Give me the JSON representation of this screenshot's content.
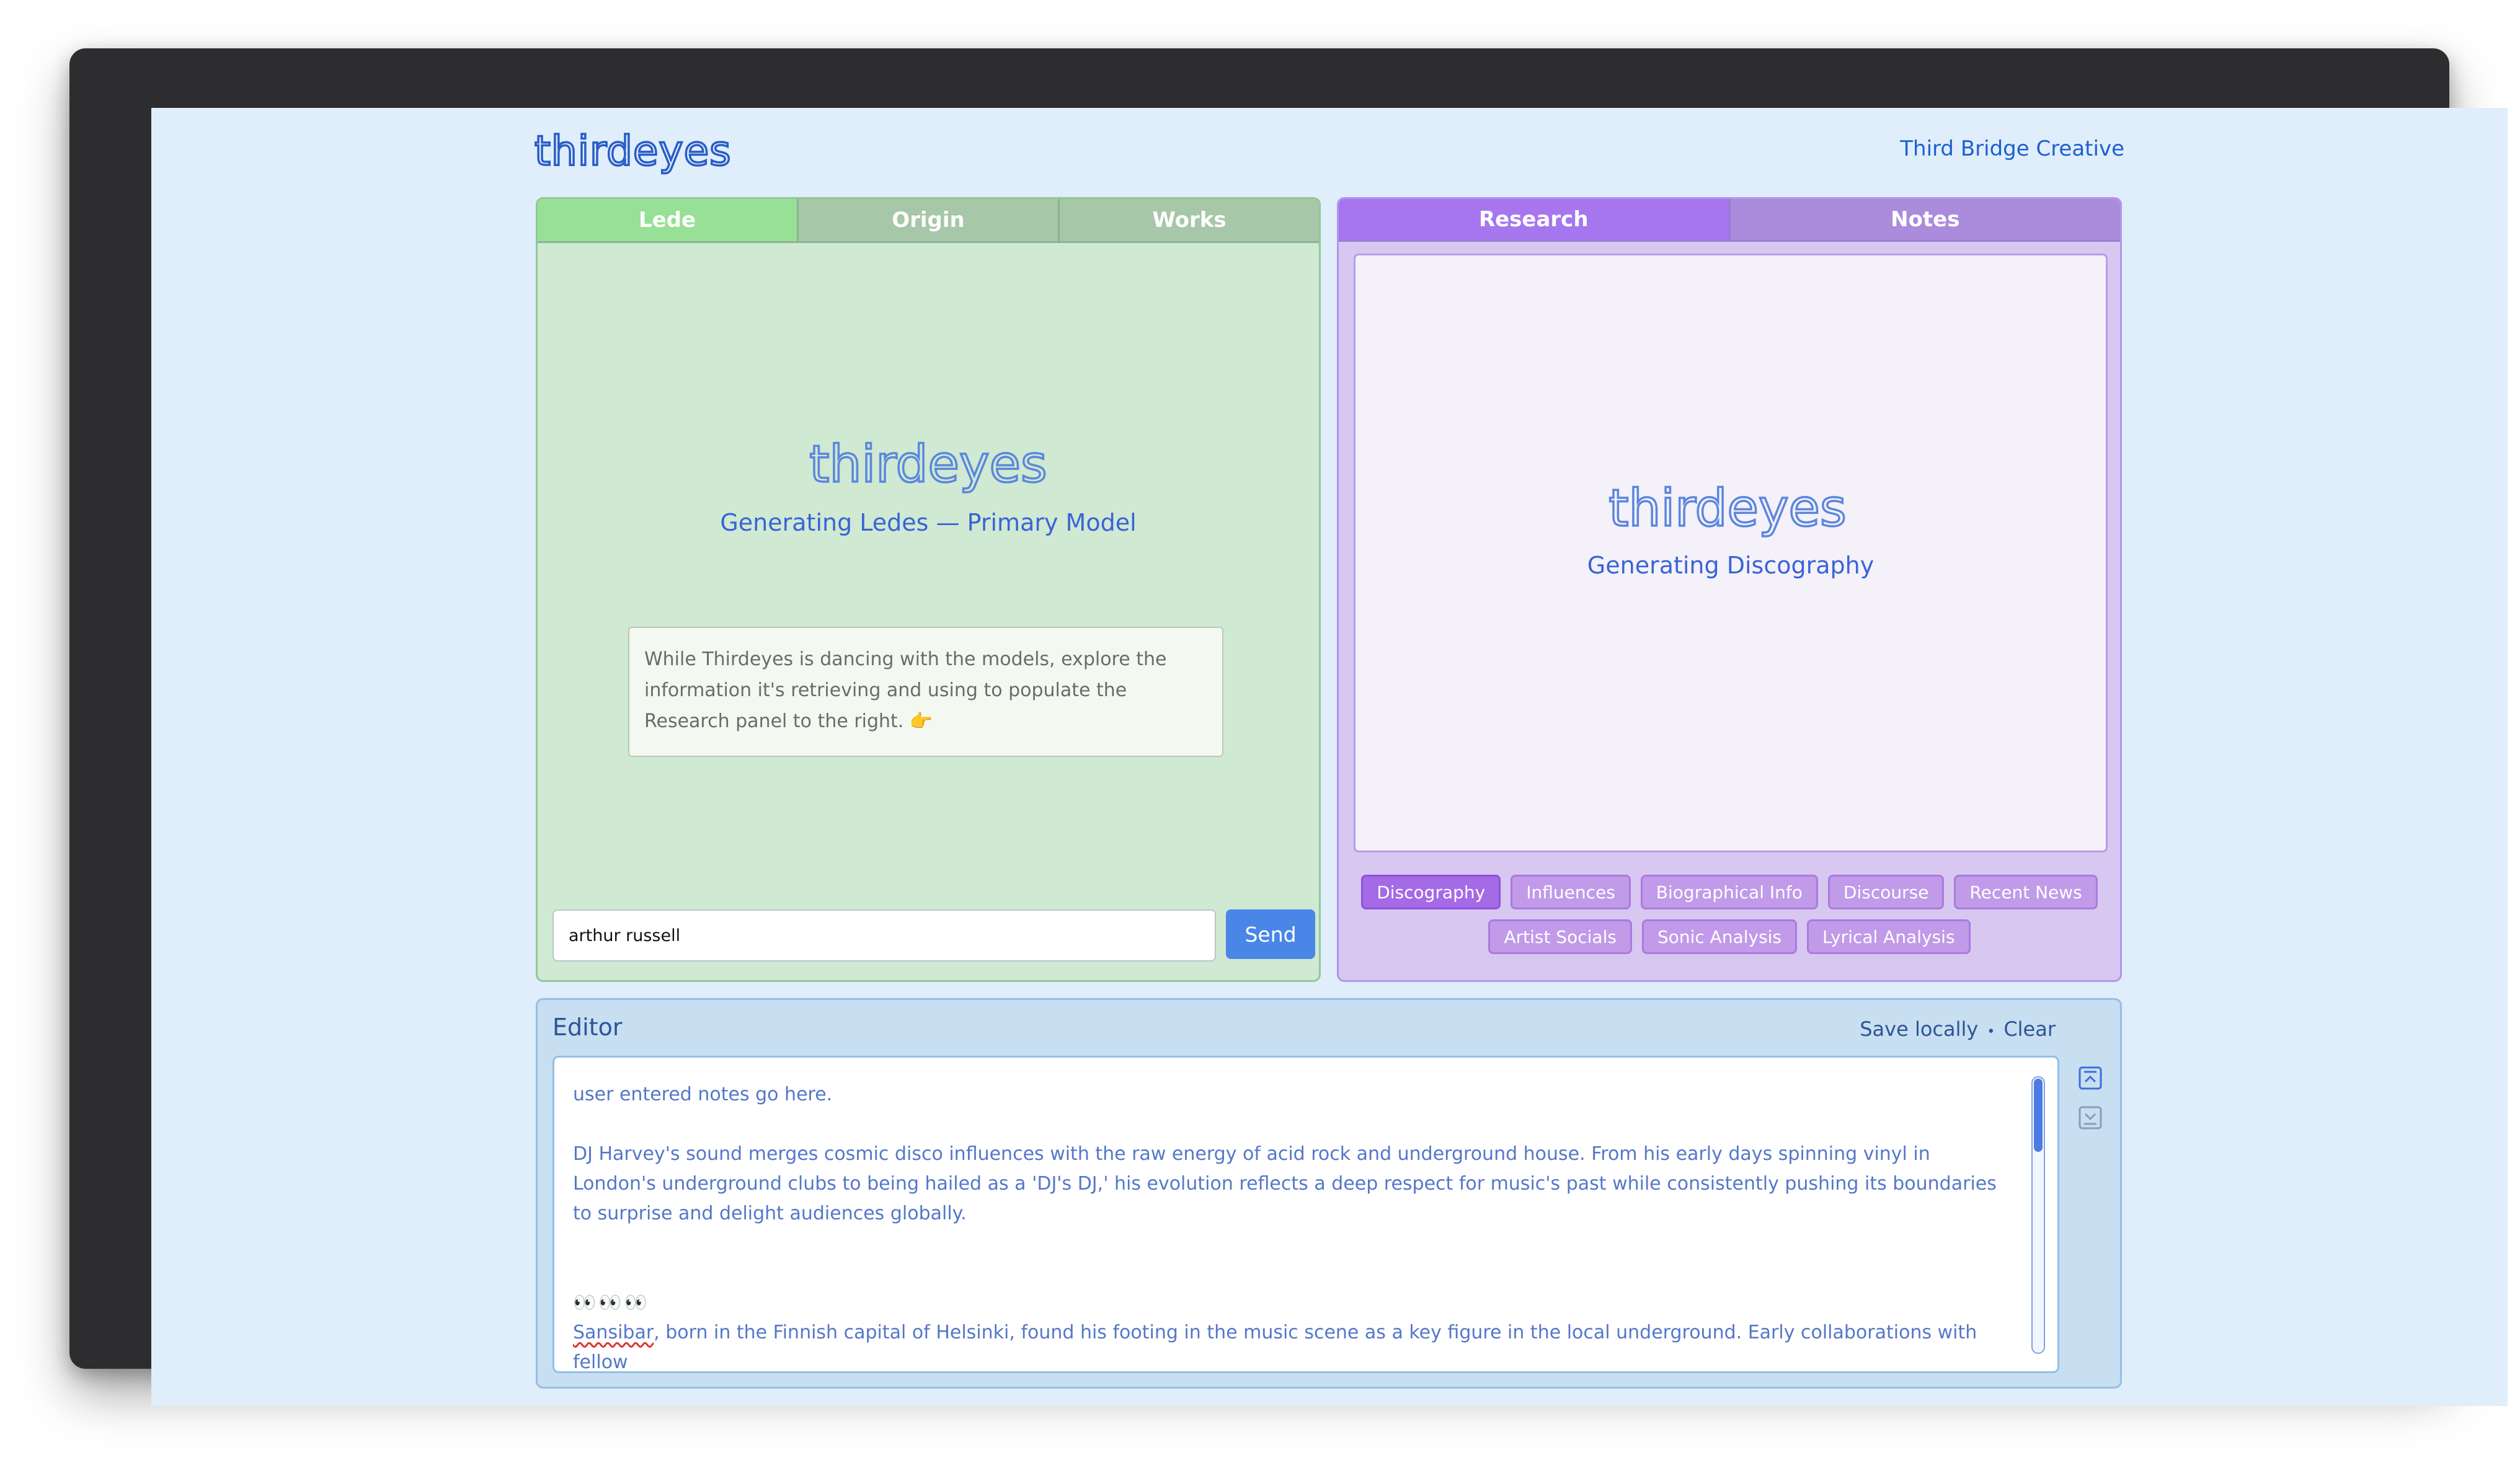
{
  "header": {
    "brand": "thirdeyes",
    "link": "Third Bridge Creative"
  },
  "left_panel": {
    "tabs": [
      {
        "label": "Lede",
        "active": true
      },
      {
        "label": "Origin",
        "active": false
      },
      {
        "label": "Works",
        "active": false
      }
    ],
    "logo_text": "thirdeyes",
    "status": "Generating Ledes — Primary Model",
    "info": "While Thirdeyes is dancing with the models, explore the information it's retrieving and using to populate the Research panel to the right. 👉",
    "input_value": "arthur russell",
    "send_label": "Send"
  },
  "right_panel": {
    "tabs": [
      {
        "label": "Research",
        "active": true
      },
      {
        "label": "Notes",
        "active": false
      }
    ],
    "logo_text": "thirdeyes",
    "status": "Generating Discography",
    "chips_row1": [
      "Discography",
      "Influences",
      "Biographical Info",
      "Discourse",
      "Recent News"
    ],
    "chips_row2": [
      "Artist Socials",
      "Sonic Analysis",
      "Lyrical Analysis"
    ],
    "active_chip": "Discography"
  },
  "editor": {
    "title": "Editor",
    "save_label": "Save locally",
    "separator": "•",
    "clear_label": "Clear",
    "line1": "user entered notes go here.",
    "para1": "DJ Harvey's sound merges cosmic disco influences with the raw energy of acid rock and underground house. From his early days spinning vinyl in London's underground clubs to being hailed as a 'DJ's DJ,' his evolution reflects a deep respect for music's past while consistently pushing its boundaries to surprise and delight audiences globally.",
    "eyes": "👀👀👀",
    "para2_word": "Sansibar",
    "para2_rest": ", born in the Finnish capital of Helsinki, found his footing in the music scene as a key figure in the local underground. Early collaborations with fellow"
  },
  "colors": {
    "accent_blue": "#4a86e8",
    "lede_green": "#97e095",
    "research_purple": "#a676ef",
    "background": "#dfeefa"
  },
  "icons": [
    "expand-up-icon",
    "collapse-down-icon",
    "pointing-right-icon",
    "eyes-icon"
  ]
}
